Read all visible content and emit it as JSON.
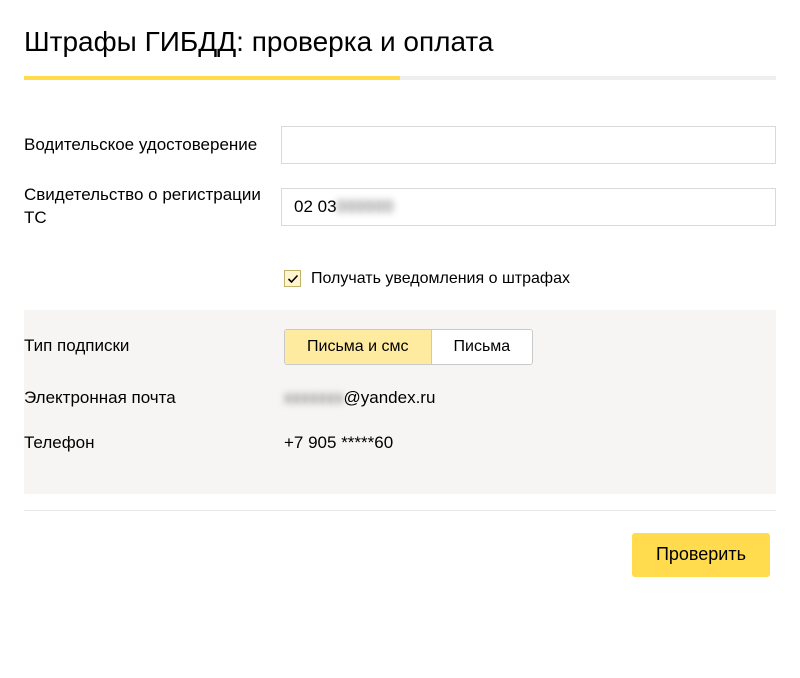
{
  "header": {
    "title": "Штрафы ГИБДД: проверка и оплата"
  },
  "progress_percent": 50,
  "fields": {
    "license": {
      "label": "Водительское удостоверение",
      "value": ""
    },
    "registration": {
      "label": "Свидетельство о регистрации ТС",
      "value_visible": "02 03 ",
      "value_obscured": "000000"
    }
  },
  "notify": {
    "label": "Получать уведомления о штрафах",
    "checked": true
  },
  "subscription": {
    "type_label": "Тип подписки",
    "options": {
      "both": "Письма и смс",
      "emails": "Письма"
    },
    "email": {
      "label": "Электронная почта",
      "value_obscured": "xxxxxxx",
      "value_visible": "@yandex.ru"
    },
    "phone": {
      "label": "Телефон",
      "value": "+7 905 *****60"
    }
  },
  "actions": {
    "submit": "Проверить"
  }
}
